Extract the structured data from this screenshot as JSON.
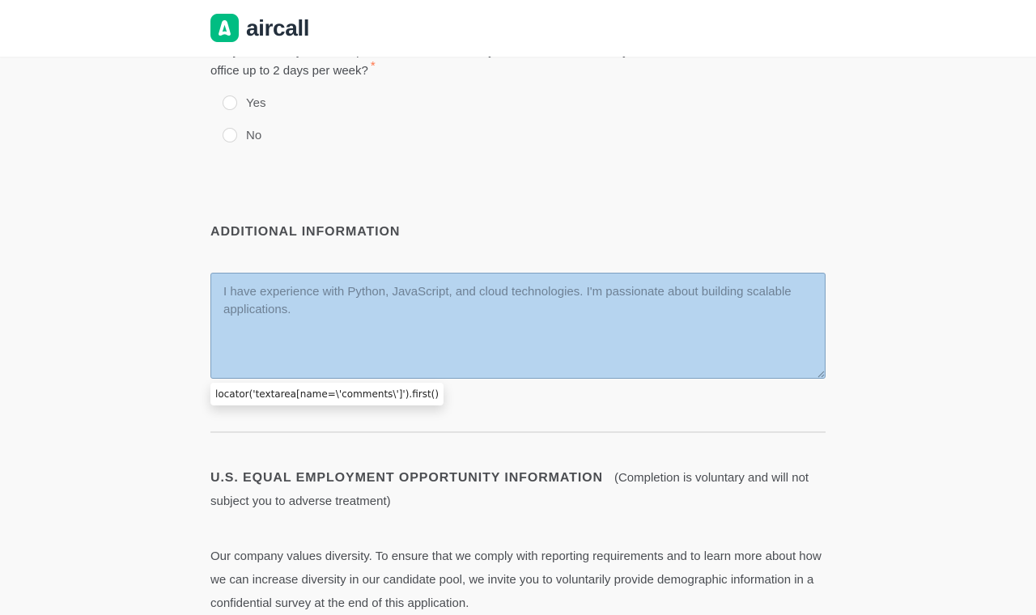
{
  "header": {
    "logo_text": "aircall",
    "brand_color": "#00bd82"
  },
  "question": {
    "text_line1_partial": "Are you currently able to report to an Aircall office if your role is based in a city with a hub and come to the",
    "text_line2": "office up to 2 days per week?",
    "required_marker": "*",
    "options": [
      {
        "label": "Yes"
      },
      {
        "label": "No"
      }
    ]
  },
  "additional_info": {
    "heading": "ADDITIONAL INFORMATION",
    "comments_value": "I have experience with Python, JavaScript, and cloud technologies. I'm passionate about building scalable applications."
  },
  "locator_tooltip": "locator('textarea[name=\\'comments\\']').first()",
  "eeo": {
    "heading": "U.S. EQUAL EMPLOYMENT OPPORTUNITY INFORMATION",
    "note": "(Completion is voluntary and will not subject you to adverse treatment)",
    "paragraph": "Our company values diversity. To ensure that we comply with reporting requirements and to learn more about how we can increase diversity in our candidate pool, we invite you to voluntarily provide demographic information in a confidential survey at the end of this application."
  },
  "colors": {
    "textarea_background": "#b6d4ef",
    "required_star": "#ff794f",
    "page_background": "#f9f9f9"
  }
}
